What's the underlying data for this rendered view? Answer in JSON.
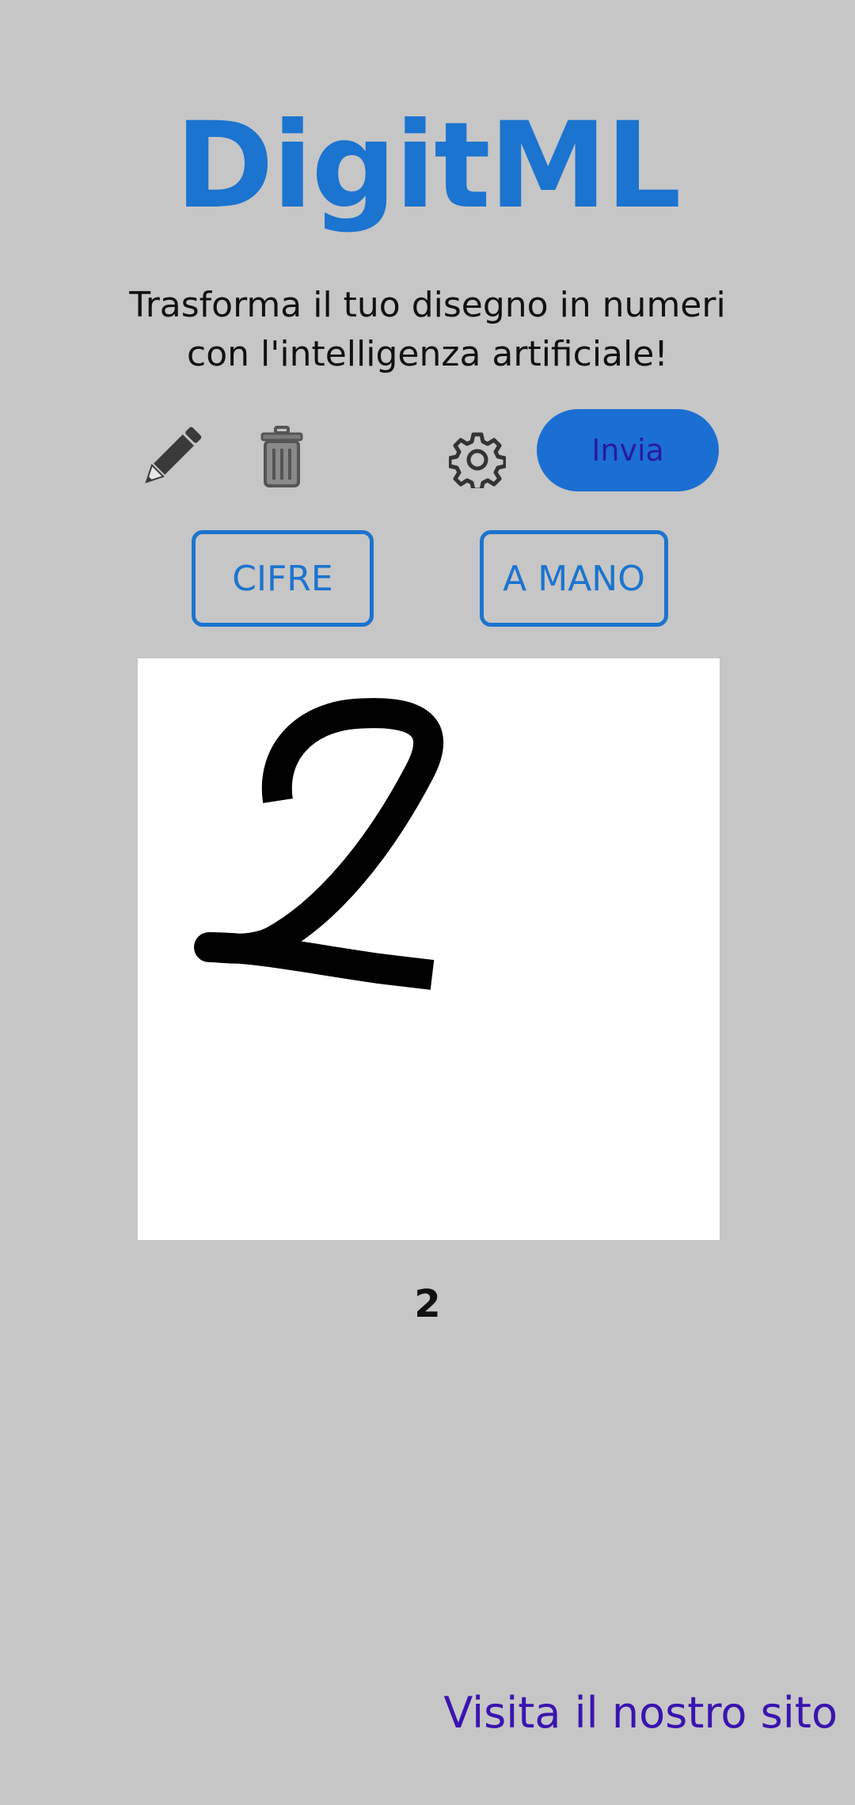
{
  "app": {
    "title": "DigitML",
    "subtitle_line1": "Trasforma il tuo disegno in numeri",
    "subtitle_line2": "con l'intelligenza artificiale!"
  },
  "toolbar": {
    "pencil_icon": "pencil-icon",
    "trash_icon": "trash-icon",
    "settings_icon": "gear-icon",
    "send_label": "Invia"
  },
  "modes": {
    "digits_label": "CIFRE",
    "handwritten_label": "A MANO"
  },
  "canvas": {
    "drawn_digit": "2",
    "stroke_color": "#000000",
    "background": "#ffffff"
  },
  "result": {
    "prediction": "2"
  },
  "footer": {
    "link_label": "Visita il nostro sito"
  },
  "colors": {
    "accent": "#1b74cf",
    "background": "#c6c6c6",
    "link": "#3a14b0"
  }
}
